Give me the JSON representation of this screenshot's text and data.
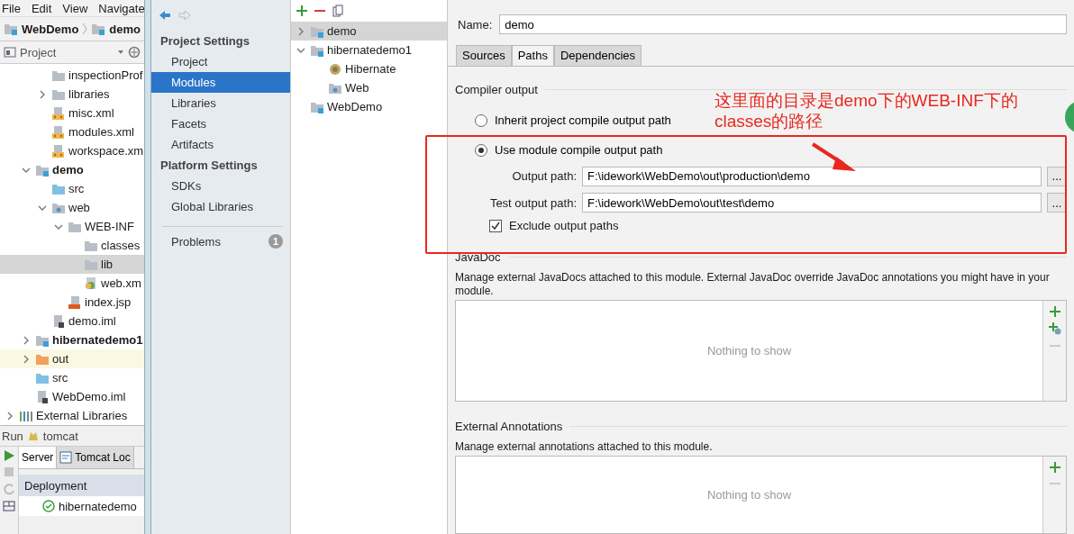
{
  "menu_bar": {
    "items": [
      "File",
      "Edit",
      "View",
      "Navigate"
    ]
  },
  "breadcrumbs": [
    "WebDemo",
    "demo"
  ],
  "project_panel": {
    "title": "Project",
    "tree": [
      {
        "children": [
          {
            "children": [
              {
                "label": "inspectionProf",
                "kind": "folder",
                "selected": false
              },
              {
                "label": "libraries",
                "kind": "folder",
                "expanded": false,
                "selected": false
              },
              {
                "label": "misc.xml",
                "kind": "xml",
                "selected": false
              },
              {
                "label": "modules.xml",
                "kind": "xml",
                "selected": false
              },
              {
                "label": "workspace.xm",
                "kind": "xml",
                "selected": false
              }
            ]
          },
          {
            "label": "demo",
            "kind": "module",
            "expanded": true,
            "selected": false,
            "children": [
              {
                "label": "src",
                "kind": "source",
                "selected": false
              },
              {
                "label": "web",
                "kind": "web",
                "expanded": true,
                "selected": false,
                "children": [
                  {
                    "label": "WEB-INF",
                    "kind": "folder",
                    "expanded": true,
                    "selected": false,
                    "children": [
                      {
                        "label": "classes",
                        "kind": "folder",
                        "selected": false
                      },
                      {
                        "label": "lib",
                        "kind": "folder",
                        "selected": true
                      },
                      {
                        "label": "web.xm",
                        "kind": "webxml",
                        "selected": false
                      }
                    ]
                  },
                  {
                    "label": "index.jsp",
                    "kind": "jsp",
                    "selected": false
                  }
                ]
              },
              {
                "label": "demo.iml",
                "kind": "iml",
                "selected": false
              }
            ]
          },
          {
            "label": "hibernatedemo1",
            "kind": "module",
            "expanded": false,
            "selected": false
          },
          {
            "label": "out",
            "kind": "excluded",
            "expanded": false,
            "selected": false
          },
          {
            "label": "src",
            "kind": "source",
            "selected": false
          },
          {
            "label": "WebDemo.iml",
            "kind": "iml",
            "selected": false
          }
        ]
      },
      {
        "label": "External Libraries",
        "kind": "libraries",
        "expanded": false,
        "selected": false
      }
    ]
  },
  "run_panel": {
    "title": "Run",
    "config": "tomcat",
    "tabs": [
      {
        "label": "Server",
        "selected": true
      },
      {
        "label": "Tomcat Loc",
        "selected": false
      }
    ],
    "deployment_header": "Deployment",
    "deployments": [
      {
        "label": "hibernatedemo"
      }
    ]
  },
  "settings_dialog": {
    "sidebar": {
      "sections": [
        {
          "title": "Project Settings",
          "items": [
            {
              "label": "Project",
              "selected": false
            },
            {
              "label": "Modules",
              "selected": true
            },
            {
              "label": "Libraries",
              "selected": false
            },
            {
              "label": "Facets",
              "selected": false
            },
            {
              "label": "Artifacts",
              "selected": false
            }
          ]
        },
        {
          "title": "Platform Settings",
          "items": [
            {
              "label": "SDKs",
              "selected": false
            },
            {
              "label": "Global Libraries",
              "selected": false
            }
          ]
        }
      ],
      "problems": {
        "label": "Problems",
        "count": "1"
      }
    },
    "module_tree": [
      {
        "label": "demo",
        "kind": "module",
        "expanded": false,
        "selected": true
      },
      {
        "label": "hibernatedemo1",
        "kind": "module",
        "expanded": true,
        "selected": false,
        "children": [
          {
            "label": "Hibernate",
            "kind": "hibernate",
            "selected": false
          },
          {
            "label": "Web",
            "kind": "web",
            "selected": false
          }
        ]
      },
      {
        "label": "WebDemo",
        "kind": "module",
        "selected": false
      }
    ],
    "name_label": "Name:",
    "name_value": "demo",
    "tabs": [
      {
        "label": "Sources",
        "selected": false
      },
      {
        "label": "Paths",
        "selected": true
      },
      {
        "label": "Dependencies",
        "selected": false
      }
    ],
    "compiler_output": {
      "title": "Compiler output",
      "options": [
        {
          "label": "Inherit project compile output path",
          "selected": false
        },
        {
          "label": "Use module compile output path",
          "selected": true
        }
      ],
      "paths": [
        {
          "label": "Output path:",
          "value": "F:\\idework\\WebDemo\\out\\production\\demo",
          "button": "..."
        },
        {
          "label": "Test output path:",
          "value": "F:\\idework\\WebDemo\\out\\test\\demo",
          "button": "..."
        }
      ],
      "exclude": {
        "label": "Exclude output paths",
        "checked": true
      }
    },
    "javadoc": {
      "title": "JavaDoc",
      "description": "Manage external JavaDocs attached to this module. External JavaDoc override JavaDoc annotations you might have in your module.",
      "empty_text": "Nothing to show",
      "tools": [
        {
          "kind": "add",
          "disabled": false
        },
        {
          "kind": "attach",
          "disabled": false
        },
        {
          "kind": "remove",
          "disabled": true
        }
      ]
    },
    "external_annotations": {
      "title": "External Annotations",
      "description": "Manage external annotations attached to this module.",
      "empty_text": "Nothing to show",
      "tools": [
        {
          "kind": "add",
          "disabled": false
        },
        {
          "kind": "remove",
          "disabled": true
        }
      ]
    }
  },
  "annotation": {
    "text": "这里面的目录是demo下的WEB-INF下的classes的路径"
  }
}
